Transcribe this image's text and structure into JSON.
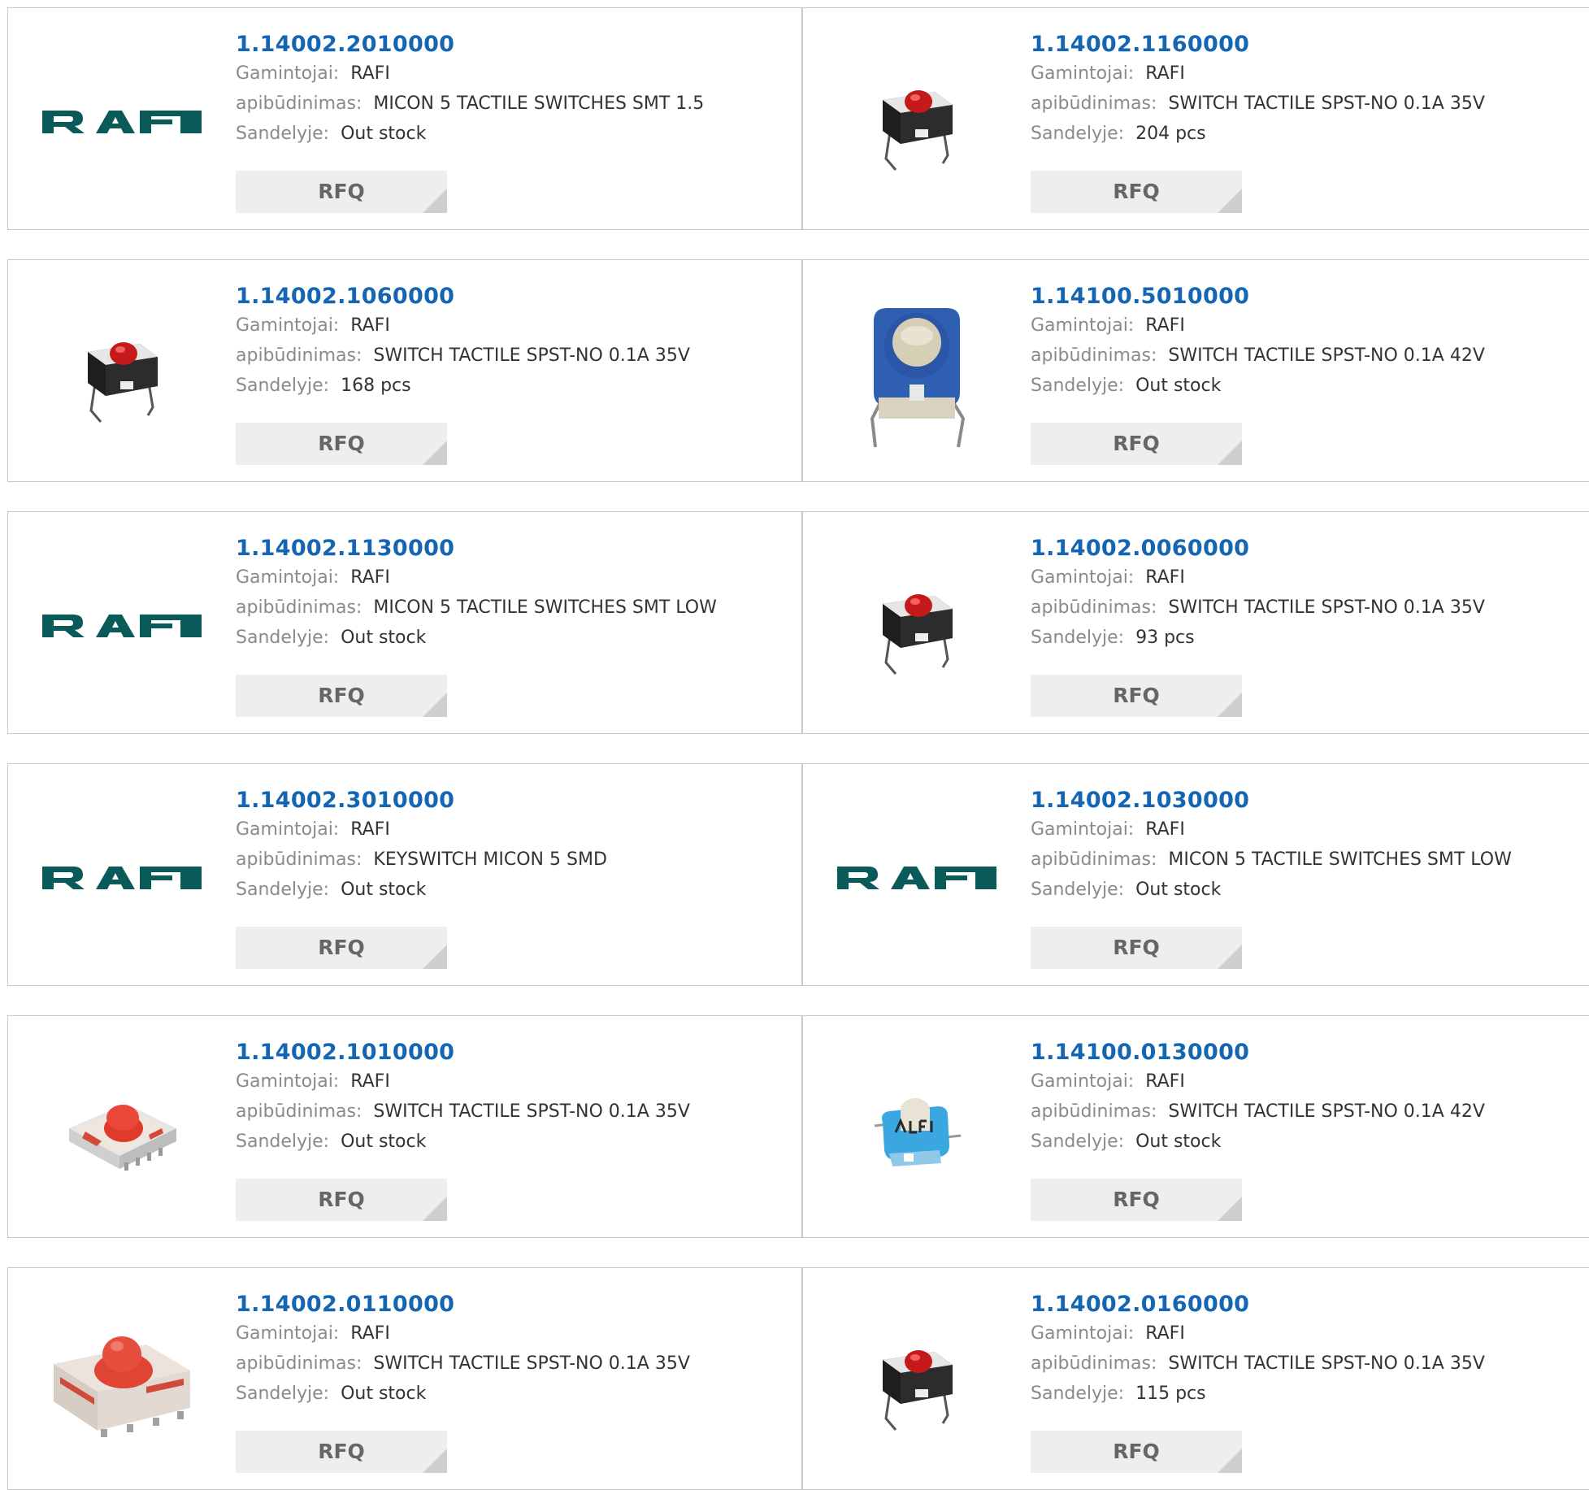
{
  "labels": {
    "manufacturer": "Gamintojai:",
    "description": "apibūdinimas:",
    "stock": "Sandelyje:",
    "rfq": "RFQ"
  },
  "colors": {
    "part_number": "#1466b3",
    "rafi_logo": "#0b5a5a",
    "rfq_bg": "#eeeeee"
  },
  "products": [
    {
      "part": "1.14002.2010000",
      "manufacturer": "RAFI",
      "description": "MICON 5 TACTILE SWITCHES SMT 1.5",
      "stock": "Out stock",
      "image": "rafi-logo"
    },
    {
      "part": "1.14002.1160000",
      "manufacturer": "RAFI",
      "description": "SWITCH TACTILE SPST-NO 0.1A 35V",
      "stock": "204 pcs",
      "image": "red-tactile-switch"
    },
    {
      "part": "1.14002.1060000",
      "manufacturer": "RAFI",
      "description": "SWITCH TACTILE SPST-NO 0.1A 35V",
      "stock": "168 pcs",
      "image": "red-tactile-switch"
    },
    {
      "part": "1.14100.5010000",
      "manufacturer": "RAFI",
      "description": "SWITCH TACTILE SPST-NO 0.1A 42V",
      "stock": "Out stock",
      "image": "blue-tactile-switch-large"
    },
    {
      "part": "1.14002.1130000",
      "manufacturer": "RAFI",
      "description": "MICON 5 TACTILE SWITCHES SMT LOW",
      "stock": "Out stock",
      "image": "rafi-logo"
    },
    {
      "part": "1.14002.0060000",
      "manufacturer": "RAFI",
      "description": "SWITCH TACTILE SPST-NO 0.1A 35V",
      "stock": "93 pcs",
      "image": "red-tactile-switch"
    },
    {
      "part": "1.14002.3010000",
      "manufacturer": "RAFI",
      "description": "KEYSWITCH MICON 5 SMD",
      "stock": "Out stock",
      "image": "rafi-logo"
    },
    {
      "part": "1.14002.1030000",
      "manufacturer": "RAFI",
      "description": "MICON 5 TACTILE SWITCHES SMT LOW",
      "stock": "Out stock",
      "image": "rafi-logo"
    },
    {
      "part": "1.14002.1010000",
      "manufacturer": "RAFI",
      "description": "SWITCH TACTILE SPST-NO 0.1A 35V",
      "stock": "Out stock",
      "image": "smd-red-switch"
    },
    {
      "part": "1.14100.0130000",
      "manufacturer": "RAFI",
      "description": "SWITCH TACTILE SPST-NO 0.1A 42V",
      "stock": "Out stock",
      "image": "blue-tactile-switch-small"
    },
    {
      "part": "1.14002.0110000",
      "manufacturer": "RAFI",
      "description": "SWITCH TACTILE SPST-NO 0.1A 35V",
      "stock": "Out stock",
      "image": "smd-red-switch-large"
    },
    {
      "part": "1.14002.0160000",
      "manufacturer": "RAFI",
      "description": "SWITCH TACTILE SPST-NO 0.1A 35V",
      "stock": "115 pcs",
      "image": "red-tactile-switch"
    }
  ]
}
